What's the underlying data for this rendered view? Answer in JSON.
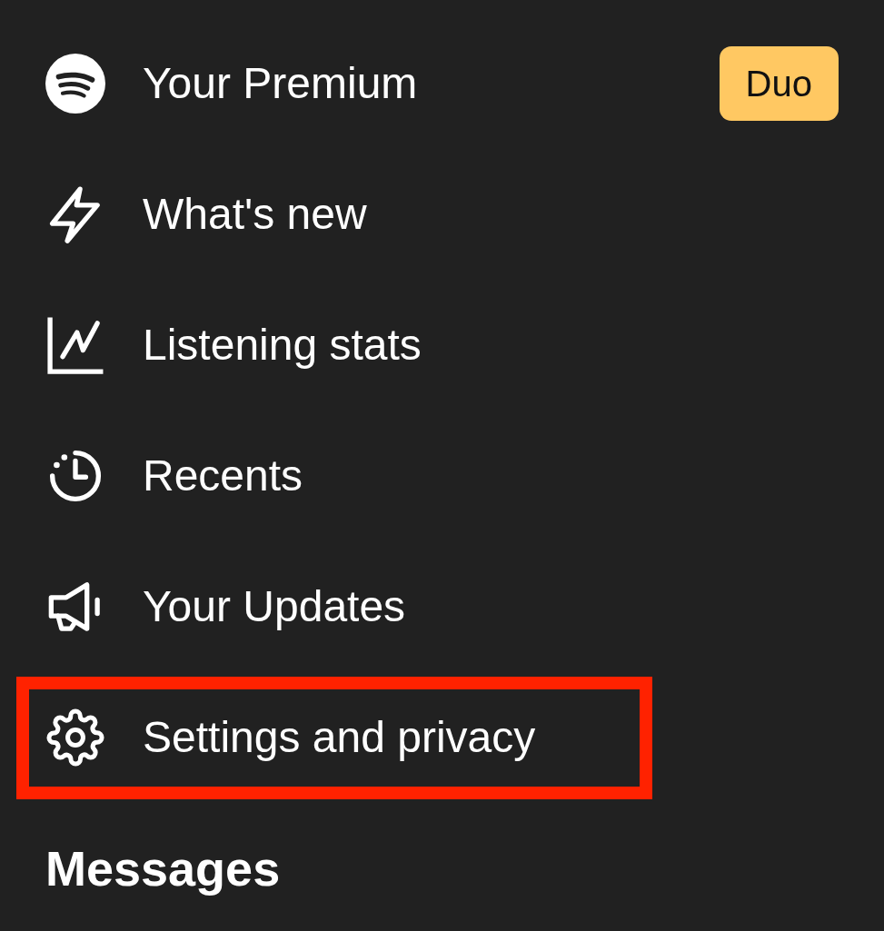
{
  "menu": {
    "items": [
      {
        "label": "Your Premium",
        "badge": "Duo",
        "highlighted": false
      },
      {
        "label": "What's new",
        "highlighted": false
      },
      {
        "label": "Listening stats",
        "highlighted": false
      },
      {
        "label": "Recents",
        "highlighted": false
      },
      {
        "label": "Your Updates",
        "highlighted": false
      },
      {
        "label": "Settings and privacy",
        "highlighted": true
      }
    ]
  },
  "section_heading": "Messages"
}
